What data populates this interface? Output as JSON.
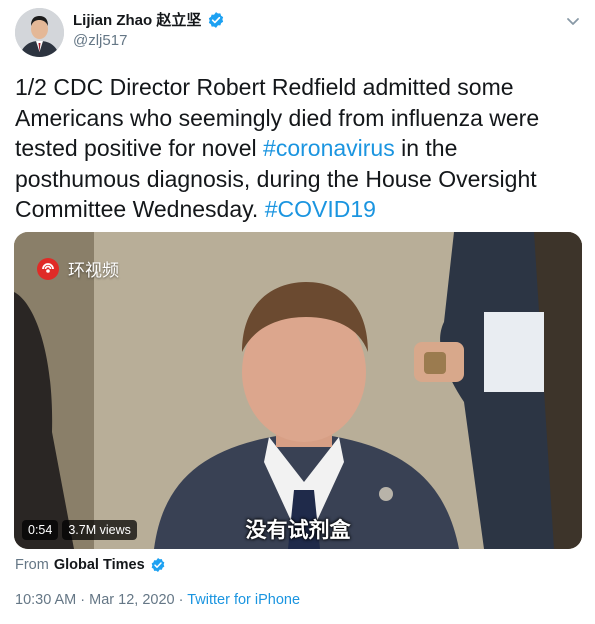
{
  "colors": {
    "link": "#1b95e0",
    "text": "#14171a",
    "muted": "#657786",
    "verified": "#1da1f2"
  },
  "author": {
    "name": "Lijian Zhao 赵立坚",
    "handle": "@zlj517",
    "verified_icon": "verified-badge-icon",
    "menu_icon": "chevron-down-icon"
  },
  "tweet": {
    "text_before": "1/2 CDC Director Robert Redfield admitted some Americans who seemingly died from influenza were tested positive for novel ",
    "hashtag1": "#coronavirus",
    "text_middle": " in the posthumous diagnosis, during the House Oversight Committee Wednesday. ",
    "hashtag2": "#COVID19"
  },
  "media": {
    "channel_logo_text": "环视频",
    "subtitle": "没有试剂盒",
    "duration": "0:54",
    "views": "3.7M views"
  },
  "from": {
    "prefix": "From",
    "source": "Global Times"
  },
  "meta": {
    "time": "10:30 AM",
    "separator": " · ",
    "date": "Mar 12, 2020",
    "client": "Twitter for iPhone"
  }
}
